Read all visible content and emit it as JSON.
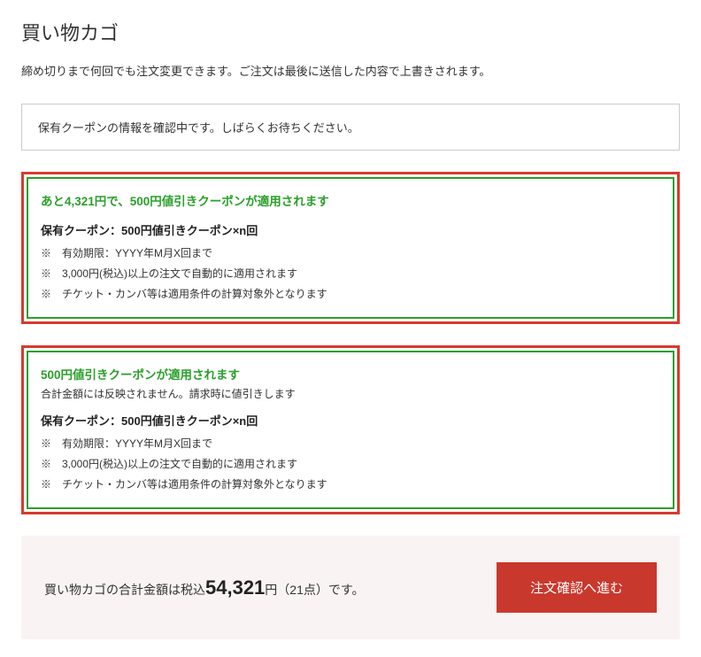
{
  "page": {
    "title": "買い物カゴ",
    "subtext": "締め切りまで何回でも注文変更できます。ご注文は最後に送信した内容で上書きされます。"
  },
  "info_box": {
    "message": "保有クーポンの情報を確認中です。しばらくお待ちください。"
  },
  "coupon1": {
    "title": "あと4,321円で、500円値引きクーポンが適用されます",
    "held": "保有クーポン：500円値引きクーポン×n回",
    "notes": [
      "※　有効期限：YYYY年M月X回まで",
      "※　3,000円(税込)以上の注文で自動的に適用されます",
      "※　チケット・カンバ等は適用条件の計算対象外となります"
    ]
  },
  "coupon2": {
    "title": "500円値引きクーポンが適用されます",
    "sub": "合計金額には反映されません。請求時に値引きします",
    "held": "保有クーポン：500円値引きクーポン×n回",
    "notes": [
      "※　有効期限：YYYY年M月X回まで",
      "※　3,000円(税込)以上の注文で自動的に適用されます",
      "※　チケット・カンバ等は適用条件の計算対象外となります"
    ]
  },
  "footer": {
    "pre": "買い物カゴの合計金額は税込",
    "amount": "54,321",
    "post": "円（21点）です。",
    "button": "注文確認へ進む"
  }
}
